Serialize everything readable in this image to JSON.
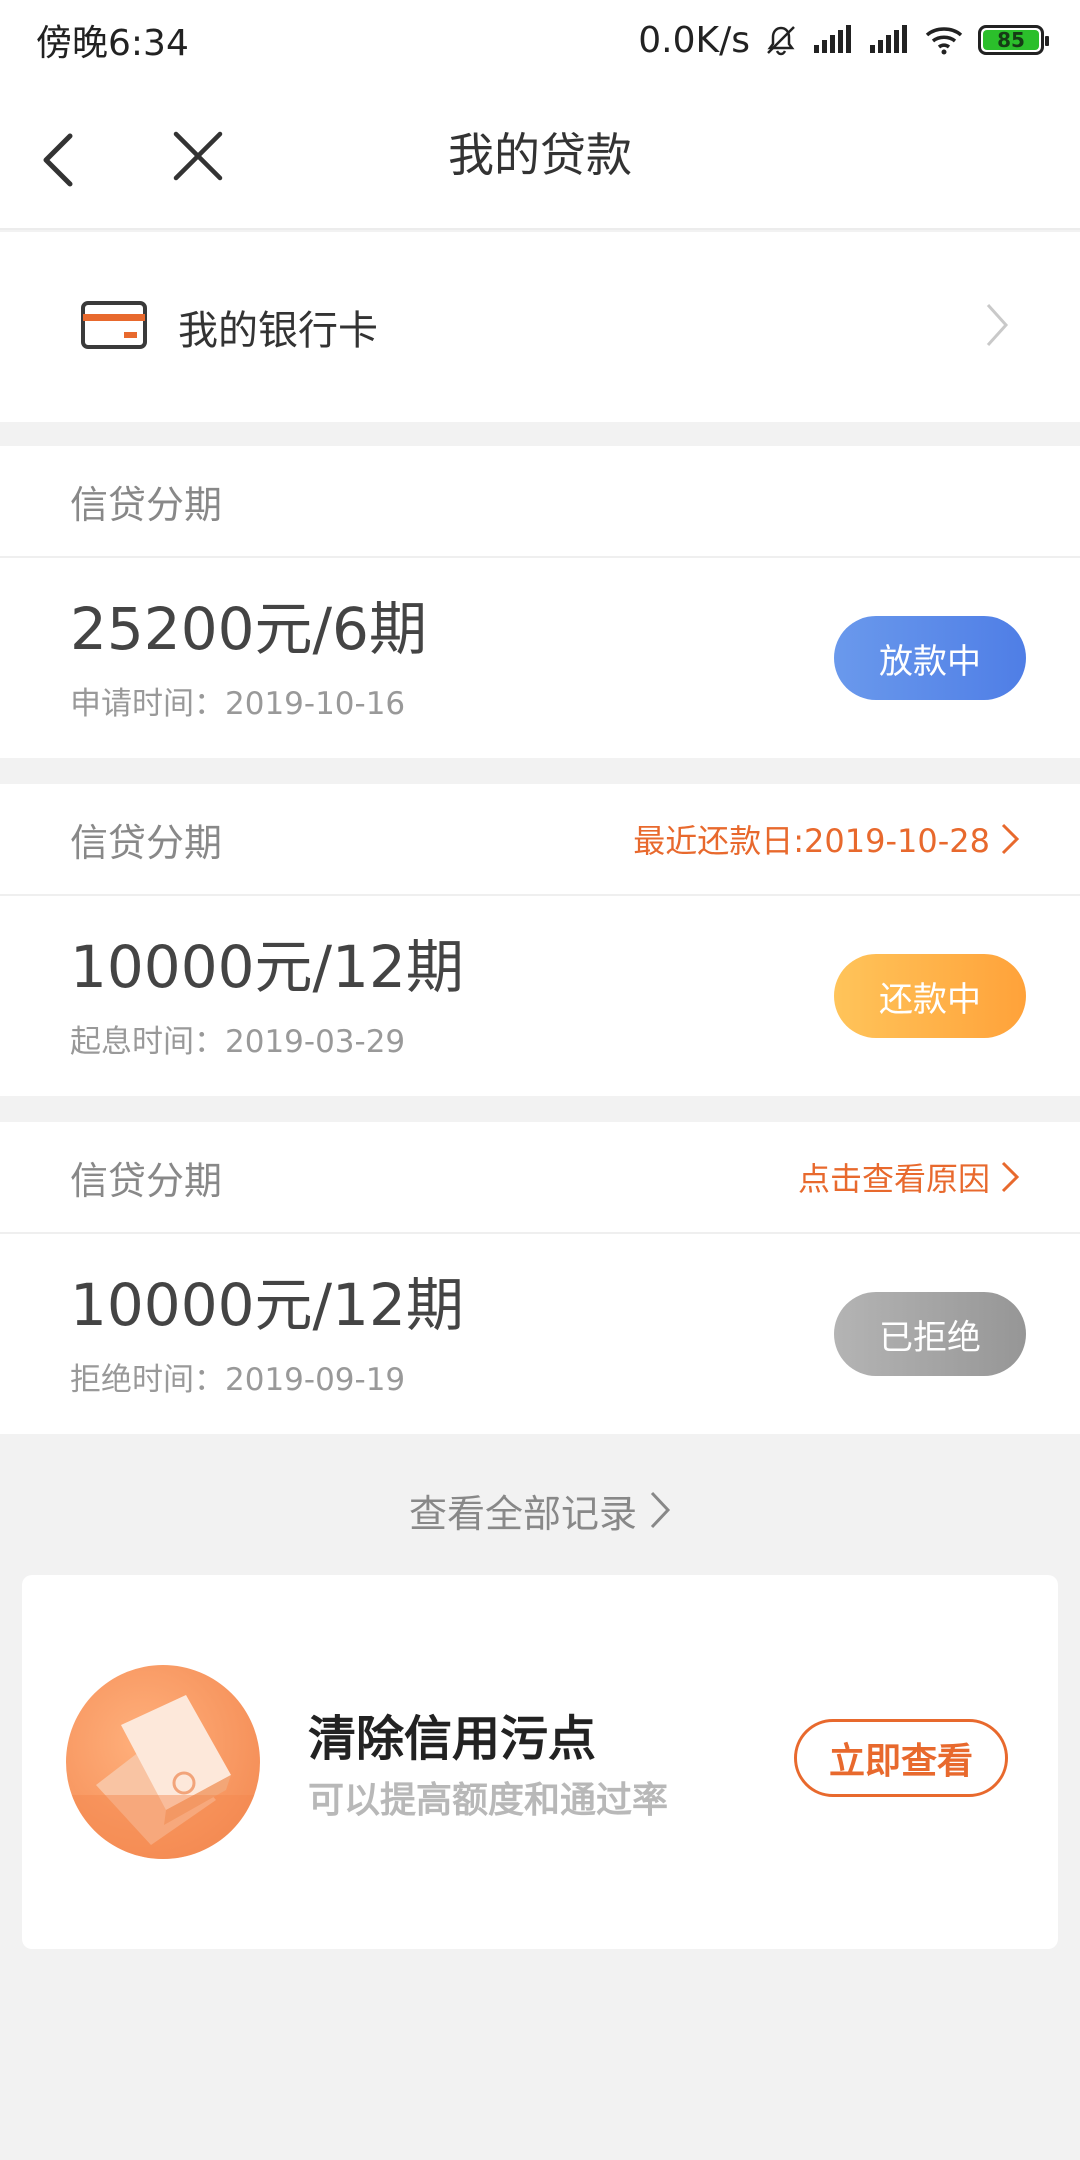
{
  "status_bar": {
    "time": "傍晚6:34",
    "net_speed": "0.0K/s",
    "battery": "85"
  },
  "nav": {
    "title": "我的贷款"
  },
  "bank_row": {
    "label": "我的银行卡"
  },
  "loans": [
    {
      "type": "信贷分期",
      "link": "",
      "amount": "25200元/6期",
      "date": "申请时间：2019-10-16",
      "status": "放款中"
    },
    {
      "type": "信贷分期",
      "link": "最近还款日:2019-10-28",
      "amount": "10000元/12期",
      "date": "起息时间：2019-03-29",
      "status": "还款中"
    },
    {
      "type": "信贷分期",
      "link": "点击查看原因",
      "amount": "10000元/12期",
      "date": "拒绝时间：2019-09-19",
      "status": "已拒绝"
    }
  ],
  "view_all": {
    "label": "查看全部记录"
  },
  "promo": {
    "title": "清除信用污点",
    "subtitle": "可以提高额度和通过率",
    "button": "立即查看"
  },
  "colors": {
    "accent": "#e8692d",
    "blue": "#5b87e8",
    "orange": "#ffae45",
    "gray": "#a6a6a6"
  }
}
